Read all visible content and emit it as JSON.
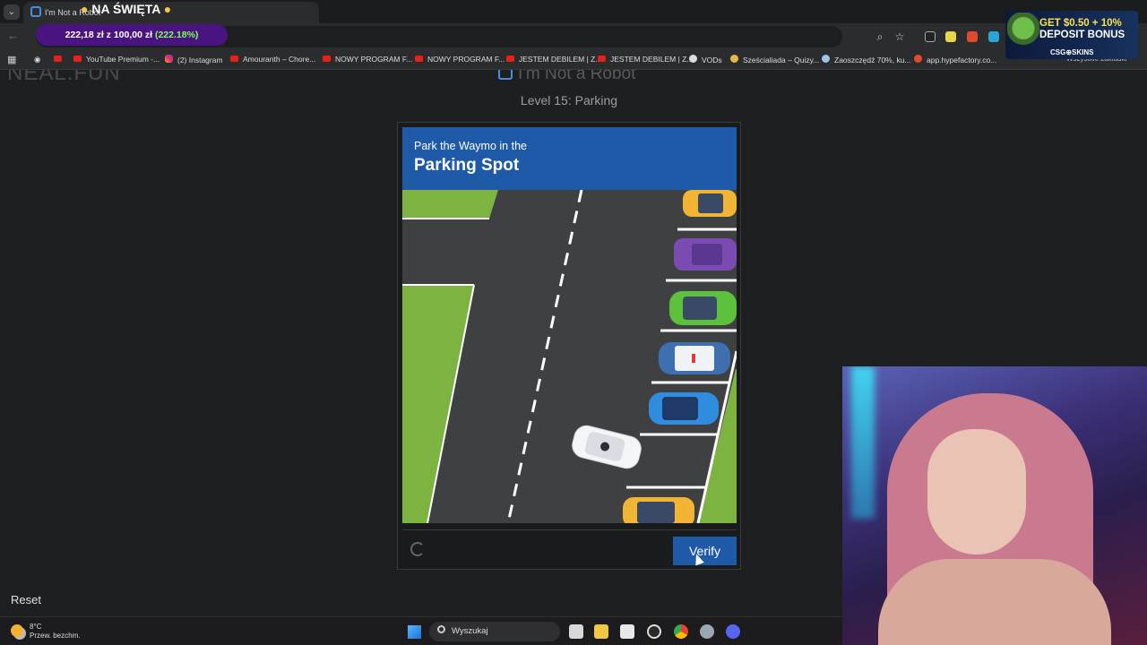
{
  "browser": {
    "tab_title": "I'm Not a Robot",
    "promo_title": "NA ŚWIĘTA",
    "progress": {
      "text": "222,18 zł z 100,00 zł",
      "percent": "(222.18%)"
    },
    "bookmarks": [
      {
        "label": "YouTube Premium -...",
        "icon": "youtube"
      },
      {
        "label": "(2) Instagram",
        "icon": "instagram"
      },
      {
        "label": "Amouranth – Chore...",
        "icon": "youtube"
      },
      {
        "label": "NOWY PROGRAM F...",
        "icon": "youtube"
      },
      {
        "label": "NOWY PROGRAM F...",
        "icon": "youtube"
      },
      {
        "label": "JESTEM DEBILEM | Z...",
        "icon": "youtube"
      },
      {
        "label": "JESTEM DEBILEM | Z...",
        "icon": "youtube"
      },
      {
        "label": "VODs",
        "icon": "globe"
      },
      {
        "label": "Sześcialiada – Quizy...",
        "icon": "quiz"
      },
      {
        "label": "Zaoszczędź 70%, ku...",
        "icon": "steam"
      },
      {
        "label": "app.hypefactory.co...",
        "icon": "hypefactory"
      }
    ],
    "other_bookmarks": "Wszystkie zakładki"
  },
  "ad": {
    "line1": "GET $0.50 + 10%",
    "line2": "DEPOSIT BONUS",
    "brand": "CSG⊕SKINS"
  },
  "page": {
    "logo": "NEAL.FUN",
    "heading": "I'm Not a Robot",
    "level": "Level 15: Parking",
    "captcha": {
      "instruction_small": "Park the Waymo in the",
      "instruction_big": "Parking Spot",
      "verify_label": "Verify"
    },
    "reset_label": "Reset"
  },
  "taskbar": {
    "weather_temp": "8°C",
    "weather_desc": "Przew. bezchm.",
    "search_placeholder": "Wyszukaj"
  }
}
